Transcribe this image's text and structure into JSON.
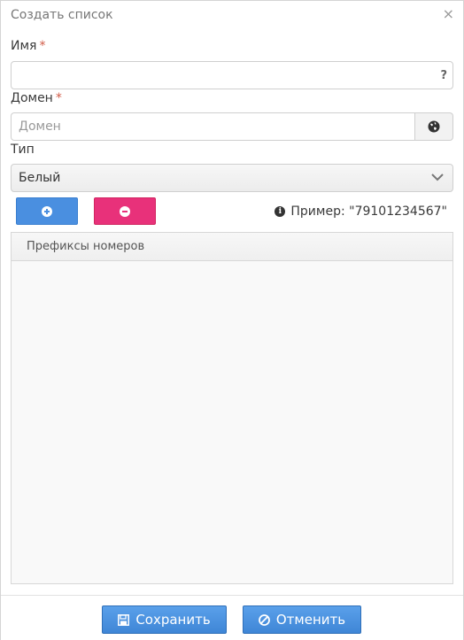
{
  "dialog": {
    "title": "Создать список",
    "close_glyph": "×"
  },
  "form": {
    "name_label": "Имя",
    "required_mark": "*",
    "name_value": "",
    "name_help": "?",
    "domain_label": "Домен",
    "domain_placeholder": "Домен",
    "type_label": "Тип",
    "type_value": "Белый"
  },
  "toolbar": {
    "add_icon": "plus-circle-icon",
    "remove_icon": "minus-circle-icon",
    "example_text": "Пример: \"79101234567\""
  },
  "table": {
    "columns": [
      "Префиксы номеров"
    ],
    "rows": []
  },
  "footer": {
    "save_label": "Сохранить",
    "cancel_label": "Отменить"
  },
  "colors": {
    "primary": "#4a8fe0",
    "danger": "#e8317a",
    "required": "#d15b47"
  }
}
